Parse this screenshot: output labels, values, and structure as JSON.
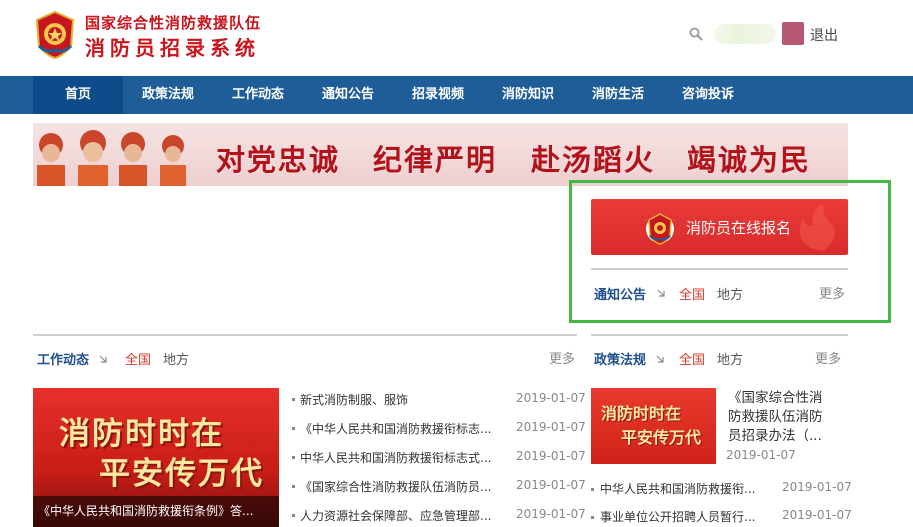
{
  "header": {
    "title_line1": "国家综合性消防救援队伍",
    "title_line2": "消防员招录系统",
    "logout_label": "退出",
    "icons": [
      "fire-rescue-emblem-icon",
      "search-icon"
    ]
  },
  "nav": {
    "items": [
      {
        "label": "首页",
        "active": true
      },
      {
        "label": "政策法规",
        "active": false
      },
      {
        "label": "工作动态",
        "active": false
      },
      {
        "label": "通知公告",
        "active": false
      },
      {
        "label": "招录视频",
        "active": false
      },
      {
        "label": "消防知识",
        "active": false
      },
      {
        "label": "消防生活",
        "active": false
      },
      {
        "label": "咨询投诉",
        "active": false
      }
    ]
  },
  "banner": {
    "slogans": [
      "对党忠诚",
      "纪律严明",
      "赴汤蹈火",
      "竭诚为民"
    ]
  },
  "registration": {
    "button_label": "消防员在线报名"
  },
  "notices": {
    "title": "通知公告",
    "tab_all": "全国",
    "tab_local": "地方",
    "more": "更多"
  },
  "work_news": {
    "title": "工作动态",
    "tab_all": "全国",
    "tab_local": "地方",
    "more": "更多",
    "image_slogan_1": "消防时时在",
    "image_slogan_2": "平安传万代",
    "image_caption": "《中华人民共和国消防救援衔条例》答...",
    "items": [
      {
        "text": "新式消防制服、服饰",
        "date": "2019-01-07"
      },
      {
        "text": "《中华人民共和国消防救援衔标志...",
        "date": "2019-01-07"
      },
      {
        "text": "中华人民共和国消防救援衔标志式...",
        "date": "2019-01-07"
      },
      {
        "text": "《国家综合性消防救援队伍消防员...",
        "date": "2019-01-07"
      },
      {
        "text": "人力资源社会保障部、应急管理部...",
        "date": "2019-01-07"
      }
    ]
  },
  "policy": {
    "title": "政策法规",
    "tab_all": "全国",
    "tab_local": "地方",
    "more": "更多",
    "image_slogan_1": "消防时时在",
    "image_slogan_2": "平安传万代",
    "featured_line1": "《国家综合性消",
    "featured_line2": "防救援队伍消防",
    "featured_line3": "员招录办法（...",
    "featured_date": "2019-01-07",
    "items": [
      {
        "text": "中华人民共和国消防救援衔...",
        "date": "2019-01-07"
      },
      {
        "text": "事业单位公开招聘人员暂行...",
        "date": "2019-01-07"
      }
    ]
  },
  "colors": {
    "nav_blue": "#1e5d98",
    "title_red": "#c8161d",
    "highlight_green": "#43b843",
    "register_red": "#e03030"
  }
}
